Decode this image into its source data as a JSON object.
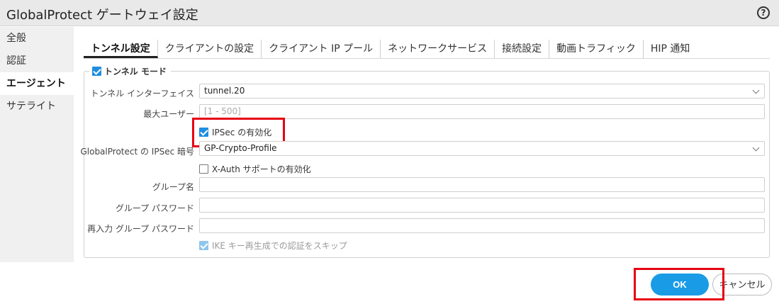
{
  "window": {
    "title": "GlobalProtect ゲートウェイ設定",
    "help_icon": "question-circle-icon",
    "help_glyph": "?"
  },
  "sidebar": {
    "items": [
      {
        "label": "全般",
        "active": false
      },
      {
        "label": "認証",
        "active": false
      },
      {
        "label": "エージェント",
        "active": true
      },
      {
        "label": "サテライト",
        "active": false
      }
    ]
  },
  "tabs": [
    {
      "label": "トンネル設定",
      "active": true
    },
    {
      "label": "クライアントの設定",
      "active": false
    },
    {
      "label": "クライアント IP プール",
      "active": false
    },
    {
      "label": "ネットワークサービス",
      "active": false
    },
    {
      "label": "接続設定",
      "active": false
    },
    {
      "label": "動画トラフィック",
      "active": false
    },
    {
      "label": "HIP 通知",
      "active": false
    }
  ],
  "tunnel": {
    "legend": "トンネル モード",
    "legend_checked": true,
    "interface_label": "トンネル インターフェイス",
    "interface_value": "tunnel.20",
    "max_users_label": "最大ユーザー",
    "max_users_placeholder": "[1 - 500]",
    "ipsec_enable_label": "IPSec の有効化",
    "ipsec_enable_checked": true,
    "ipsec_crypto_label": "GlobalProtect の IPSec 暗号",
    "ipsec_crypto_value": "GP-Crypto-Profile",
    "xauth_label": "X-Auth サポートの有効化",
    "xauth_checked": false,
    "group_name_label": "グループ名",
    "group_name_value": "",
    "group_password_label": "グループ パスワード",
    "group_password_value": "",
    "reenter_password_label": "再入力 グループ パスワード",
    "reenter_password_value": "",
    "skip_auth_label": "IKE キー再生成での認証をスキップ",
    "skip_auth_checked": true
  },
  "buttons": {
    "ok": "OK",
    "cancel": "キャンセル"
  },
  "colors": {
    "primary": "#1a9be6",
    "checkbox": "#1f8ee0",
    "highlight": "#e60012"
  }
}
